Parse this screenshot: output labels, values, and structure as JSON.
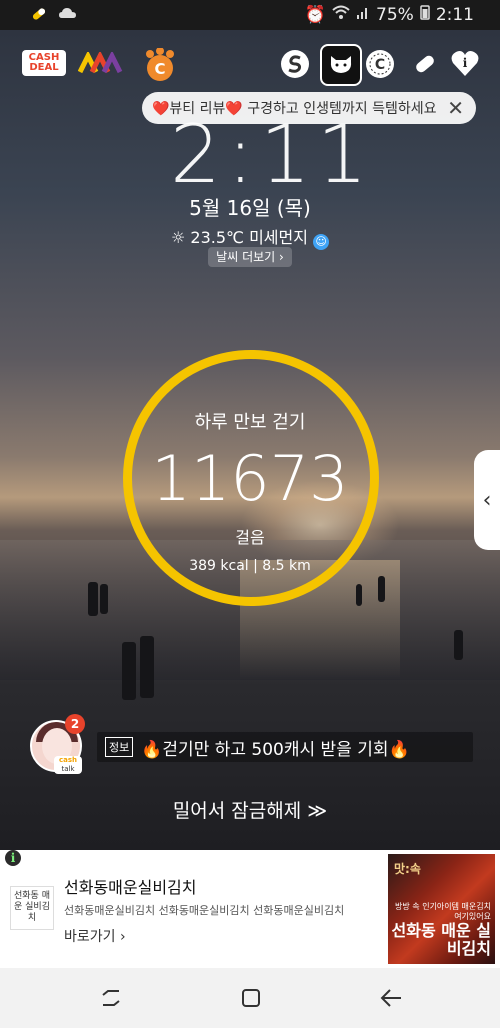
{
  "statusbar": {
    "battery": "75%",
    "time": "2:11"
  },
  "topbar": {
    "cashdeal_line1": "CASH",
    "cashdeal_line2": "DEAL",
    "icons": [
      "cashdeal-icon",
      "m-logo-icon",
      "paw-c-icon",
      "s-logo-icon",
      "cat-icon",
      "c-coin-icon",
      "pill-icon",
      "heart-info-icon"
    ]
  },
  "promo": {
    "text": "❤️뷰티 리뷰❤️ 구경하고 인생템까지 득템하세요",
    "close": "✕"
  },
  "lock": {
    "clock": "2:11",
    "date": "5월 16일 (목)",
    "weather": "☼ 23.5℃ 미세먼지",
    "weather_more": "날씨 더보기 ›"
  },
  "steps": {
    "title": "하루 만보 걷기",
    "value": "11673",
    "unit": "걸음",
    "meta": "389 kcal  |  8.5 km"
  },
  "notice": {
    "badge": "2",
    "cashtalk_line1": "cash",
    "cashtalk_line2": "talk",
    "tag": "정보",
    "text": "🔥걷기만 하고 500캐시 받을 기회🔥"
  },
  "unlock": {
    "label": "밀어서 잠금해제 ≫"
  },
  "ad": {
    "info": "i",
    "logo_text": "선화동 매운 실비김치",
    "title": "선화동매운실비김치",
    "description": "선화동매운실비김치 선화동매운실비김치 선화동매운실비김치",
    "link": "바로가기 ›",
    "image_text1": "맛:속",
    "image_text2": "방방 속 인기아이템 매운김치 여기있어요",
    "image_text3": "선화동 매운 실비김치"
  },
  "colors": {
    "ring": "#f5c400",
    "cashdeal": "#e8432b"
  }
}
